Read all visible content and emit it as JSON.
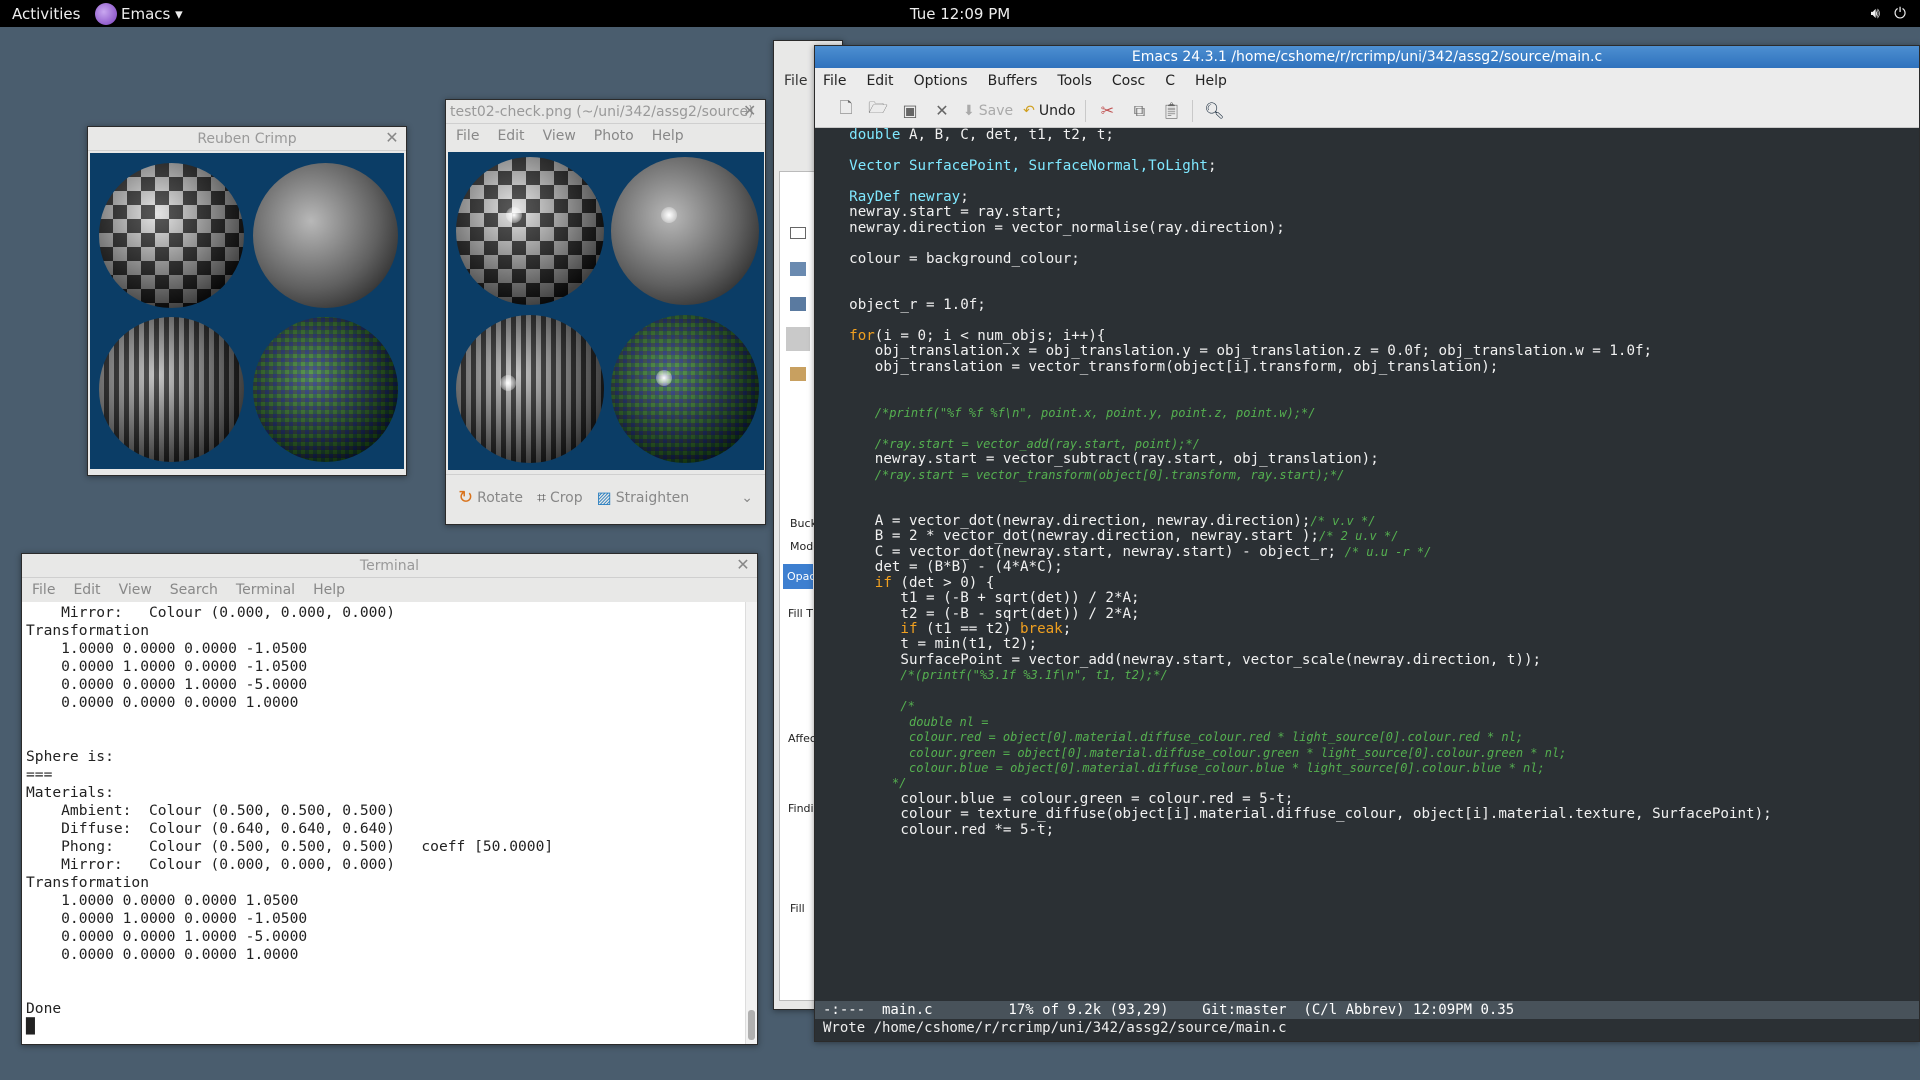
{
  "topbar": {
    "activities": "Activities",
    "app_menu": "Emacs ▾",
    "clock": "Tue 12:09 PM",
    "icons": [
      "volume-icon",
      "power-icon"
    ]
  },
  "win_render": {
    "title": "Reuben Crimp"
  },
  "win_viewer": {
    "title": "test02-check.png (~/uni/342/assg2/source)",
    "menu": [
      "File",
      "Edit",
      "View",
      "Photo",
      "Help"
    ],
    "toolbar": {
      "rotate": "Rotate",
      "crop": "Crop",
      "straighten": "Straighten"
    }
  },
  "win_partial": {
    "menu_file": "File",
    "labels": [
      "Buck",
      "Mode",
      "Opac",
      "Fill T",
      "Affec",
      "Findi",
      "Fill"
    ]
  },
  "terminal": {
    "title": "Terminal",
    "menu": [
      "File",
      "Edit",
      "View",
      "Search",
      "Terminal",
      "Help"
    ],
    "lines": [
      "    Mirror:   Colour (0.000, 0.000, 0.000)",
      "Transformation",
      "    1.0000 0.0000 0.0000 -1.0500",
      "    0.0000 1.0000 0.0000 -1.0500",
      "    0.0000 0.0000 1.0000 -5.0000",
      "    0.0000 0.0000 0.0000 1.0000",
      "",
      "",
      "Sphere is:",
      "===",
      "Materials:",
      "    Ambient:  Colour (0.500, 0.500, 0.500)",
      "    Diffuse:  Colour (0.640, 0.640, 0.640)",
      "    Phong:    Colour (0.500, 0.500, 0.500)   coeff [50.0000]",
      "    Mirror:   Colour (0.000, 0.000, 0.000)",
      "Transformation",
      "    1.0000 0.0000 0.0000 1.0500",
      "    0.0000 1.0000 0.0000 -1.0500",
      "    0.0000 0.0000 1.0000 -5.0000",
      "    0.0000 0.0000 0.0000 1.0000",
      "",
      "",
      "Done",
      "█"
    ]
  },
  "emacs": {
    "title": "Emacs 24.3.1 /home/cshome/r/rcrimp/uni/342/assg2/source/main.c",
    "menu": [
      "File",
      "Edit",
      "Options",
      "Buffers",
      "Tools",
      "Cosc",
      "C",
      "Help"
    ],
    "toolbar": {
      "save": "Save",
      "undo": "Undo"
    },
    "code": [
      [
        [
          "    ",
          ""
        ],
        [
          "double",
          "ty"
        ],
        [
          " A, B, C, det, t1, t2, t;",
          ""
        ]
      ],
      [
        [
          "",
          ""
        ]
      ],
      [
        [
          "    ",
          ""
        ],
        [
          "Vector",
          "ty"
        ],
        [
          " ",
          ""
        ],
        [
          "SurfacePoint, SurfaceNormal,ToLight",
          "ty"
        ],
        [
          ";",
          ""
        ]
      ],
      [
        [
          "",
          ""
        ]
      ],
      [
        [
          "    ",
          ""
        ],
        [
          "RayDef",
          "ty"
        ],
        [
          " ",
          ""
        ],
        [
          "newray",
          "ty"
        ],
        [
          ";",
          ""
        ]
      ],
      [
        [
          "    newray.start = ray.start;",
          ""
        ]
      ],
      [
        [
          "    newray.direction = vector_normalise(ray.direction);",
          ""
        ]
      ],
      [
        [
          "",
          ""
        ]
      ],
      [
        [
          "    colour = background_colour;",
          ""
        ]
      ],
      [
        [
          "",
          ""
        ]
      ],
      [
        [
          "",
          ""
        ]
      ],
      [
        [
          "    object_r = 1.0f;",
          ""
        ]
      ],
      [
        [
          "",
          ""
        ]
      ],
      [
        [
          "    ",
          ""
        ],
        [
          "for",
          "kw"
        ],
        [
          "(i = 0; i < num_objs; i++){",
          ""
        ]
      ],
      [
        [
          "       obj_translation.x = obj_translation.y = obj_translation.z = 0.0f; obj_translation.w = 1.0f;",
          ""
        ]
      ],
      [
        [
          "       obj_translation = vector_transform(object[i].transform, obj_translation);",
          ""
        ]
      ],
      [
        [
          "",
          ""
        ]
      ],
      [
        [
          "",
          ""
        ]
      ],
      [
        [
          "       ",
          ""
        ],
        [
          "/*printf(\"%f %f %f\\n\", point.x, point.y, point.z, point.w);*/",
          "cm"
        ]
      ],
      [
        [
          "",
          ""
        ]
      ],
      [
        [
          "       ",
          ""
        ],
        [
          "/*ray.start = vector_add(ray.start, point);*/",
          "cm"
        ]
      ],
      [
        [
          "       newray.start = vector_subtract(ray.start, obj_translation);",
          ""
        ]
      ],
      [
        [
          "       ",
          ""
        ],
        [
          "/*ray.start = vector_transform(object[0].transform, ray.start);*/",
          "cm"
        ]
      ],
      [
        [
          "",
          ""
        ]
      ],
      [
        [
          "",
          ""
        ]
      ],
      [
        [
          "       A = vector_dot(newray.direction, newray.direction);",
          ""
        ],
        [
          "/* v.v */",
          "cm"
        ]
      ],
      [
        [
          "       B = 2 * vector_dot(newray.direction, newray.start );",
          ""
        ],
        [
          "/* 2 u.v */",
          "cm"
        ]
      ],
      [
        [
          "       C = vector_dot(newray.start, newray.start) - object_r; ",
          ""
        ],
        [
          "/* u.u -r */",
          "cm"
        ]
      ],
      [
        [
          "       det = (B*B) - (4*A*C);",
          ""
        ]
      ],
      [
        [
          "       ",
          ""
        ],
        [
          "if",
          "kw"
        ],
        [
          " (det > 0) {",
          ""
        ]
      ],
      [
        [
          "          t1 = (-B + sqrt(det)) / 2*A;",
          ""
        ]
      ],
      [
        [
          "          t2 = (-B - sqrt(det)) / 2*A;",
          ""
        ]
      ],
      [
        [
          "          ",
          ""
        ],
        [
          "if",
          "kw"
        ],
        [
          " (t1 == t2) ",
          ""
        ],
        [
          "break",
          "kw"
        ],
        [
          ";",
          ""
        ]
      ],
      [
        [
          "          t = min(t1, t2);",
          ""
        ]
      ],
      [
        [
          "          SurfacePoint = vector_add(newray.start, vector_scale(newray.direction, t));",
          ""
        ]
      ],
      [
        [
          "          ",
          ""
        ],
        [
          "/*(printf(\"%3.1f %3.1f\\n\", t1, t2);*/",
          "cm"
        ]
      ],
      [
        [
          "",
          ""
        ]
      ],
      [
        [
          "          ",
          ""
        ],
        [
          "/*",
          "cm"
        ]
      ],
      [
        [
          "           ",
          ""
        ],
        [
          "double nl =",
          "cm"
        ]
      ],
      [
        [
          "           ",
          ""
        ],
        [
          "colour.red = object[0].material.diffuse_colour.red * light_source[0].colour.red * nl;",
          "cm"
        ]
      ],
      [
        [
          "           ",
          ""
        ],
        [
          "colour.green = object[0].material.diffuse_colour.green * light_source[0].colour.green * nl;",
          "cm"
        ]
      ],
      [
        [
          "           ",
          ""
        ],
        [
          "colour.blue = object[0].material.diffuse_colour.blue * light_source[0].colour.blue * nl;",
          "cm"
        ]
      ],
      [
        [
          "         ",
          ""
        ],
        [
          "*/",
          "cm"
        ]
      ],
      [
        [
          "          colour.blue = colour.green = colour.red = 5-t;",
          ""
        ]
      ],
      [
        [
          "          colour = texture_diffuse(object[i].material.diffuse_colour, object[i].material.texture, SurfacePoint);",
          ""
        ]
      ],
      [
        [
          "          colour.red *= 5-t;",
          ""
        ]
      ]
    ],
    "modeline": "-:---  main.c         17% of 9.2k (93,29)    Git:master  (C/l Abbrev) 12:09PM 0.35",
    "minibuffer": "Wrote /home/cshome/r/rcrimp/uni/342/assg2/source/main.c"
  }
}
